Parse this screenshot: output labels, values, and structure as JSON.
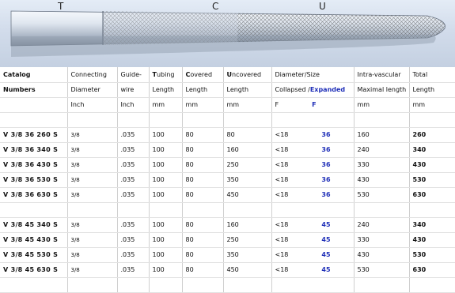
{
  "photo": {
    "letters": [
      "T",
      "C",
      "U"
    ]
  },
  "table": {
    "header_rows": [
      [
        {
          "text": "Catalog",
          "bold": true
        },
        {
          "text": "Connecting"
        },
        {
          "text": "Guide-"
        },
        {
          "lead": "T",
          "rest": "ubing"
        },
        {
          "lead": "C",
          "rest": "overed"
        },
        {
          "lead": "U",
          "rest": "ncovered"
        },
        {
          "text": "Diameter/Size"
        },
        {
          "text": "Intra-vascular"
        },
        {
          "text": "Total"
        }
      ],
      [
        {
          "text": "Numbers",
          "bold": true
        },
        {
          "text": "Diameter"
        },
        {
          "text": "wire"
        },
        {
          "text": "Length"
        },
        {
          "text": "Length"
        },
        {
          "text": "Length"
        },
        {
          "text": "Collapsed /",
          "accent": "Expanded"
        },
        {
          "text": "Maximal length"
        },
        {
          "text": "Length"
        }
      ],
      [
        {
          "text": ""
        },
        {
          "text": "Inch"
        },
        {
          "text": "Inch"
        },
        {
          "text": "mm"
        },
        {
          "text": "mm"
        },
        {
          "text": "mm"
        },
        {
          "text": "F",
          "accent": "F"
        },
        {
          "text": "mm"
        },
        {
          "text": "mm"
        }
      ]
    ],
    "group_36": [
      {
        "catalog": "V 3/8 36 260 S",
        "connecting": "3/8",
        "guidewire": ".035",
        "tubing": "100",
        "covered": "80",
        "uncovered": "80",
        "collapsed": "<18",
        "expanded": "36",
        "intravascular": "160",
        "total": "260"
      },
      {
        "catalog": "V 3/8 36 340 S",
        "connecting": "3/8",
        "guidewire": ".035",
        "tubing": "100",
        "covered": "80",
        "uncovered": "160",
        "collapsed": "<18",
        "expanded": "36",
        "intravascular": "240",
        "total": "340"
      },
      {
        "catalog": "V 3/8 36 430 S",
        "connecting": "3/8",
        "guidewire": ".035",
        "tubing": "100",
        "covered": "80",
        "uncovered": "250",
        "collapsed": "<18",
        "expanded": "36",
        "intravascular": "330",
        "total": "430"
      },
      {
        "catalog": "V 3/8 36 530 S",
        "connecting": "3/8",
        "guidewire": ".035",
        "tubing": "100",
        "covered": "80",
        "uncovered": "350",
        "collapsed": "<18",
        "expanded": "36",
        "intravascular": "430",
        "total": "530"
      },
      {
        "catalog": "V 3/8 36 630 S",
        "connecting": "3/8",
        "guidewire": ".035",
        "tubing": "100",
        "covered": "80",
        "uncovered": "450",
        "collapsed": "<18",
        "expanded": "36",
        "intravascular": "530",
        "total": "630"
      }
    ],
    "group_45": [
      {
        "catalog": "V 3/8 45 340 S",
        "connecting": "3/8",
        "guidewire": ".035",
        "tubing": "100",
        "covered": "80",
        "uncovered": "160",
        "collapsed": "<18",
        "expanded": "45",
        "intravascular": "240",
        "total": "340"
      },
      {
        "catalog": "V 3/8 45 430 S",
        "connecting": "3/8",
        "guidewire": ".035",
        "tubing": "100",
        "covered": "80",
        "uncovered": "250",
        "collapsed": "<18",
        "expanded": "45",
        "intravascular": "330",
        "total": "430"
      },
      {
        "catalog": "V 3/8 45 530 S",
        "connecting": "3/8",
        "guidewire": ".035",
        "tubing": "100",
        "covered": "80",
        "uncovered": "350",
        "collapsed": "<18",
        "expanded": "45",
        "intravascular": "430",
        "total": "530"
      },
      {
        "catalog": "V 3/8 45 630 S",
        "connecting": "3/8",
        "guidewire": ".035",
        "tubing": "100",
        "covered": "80",
        "uncovered": "450",
        "collapsed": "<18",
        "expanded": "45",
        "intravascular": "530",
        "total": "630"
      }
    ]
  }
}
